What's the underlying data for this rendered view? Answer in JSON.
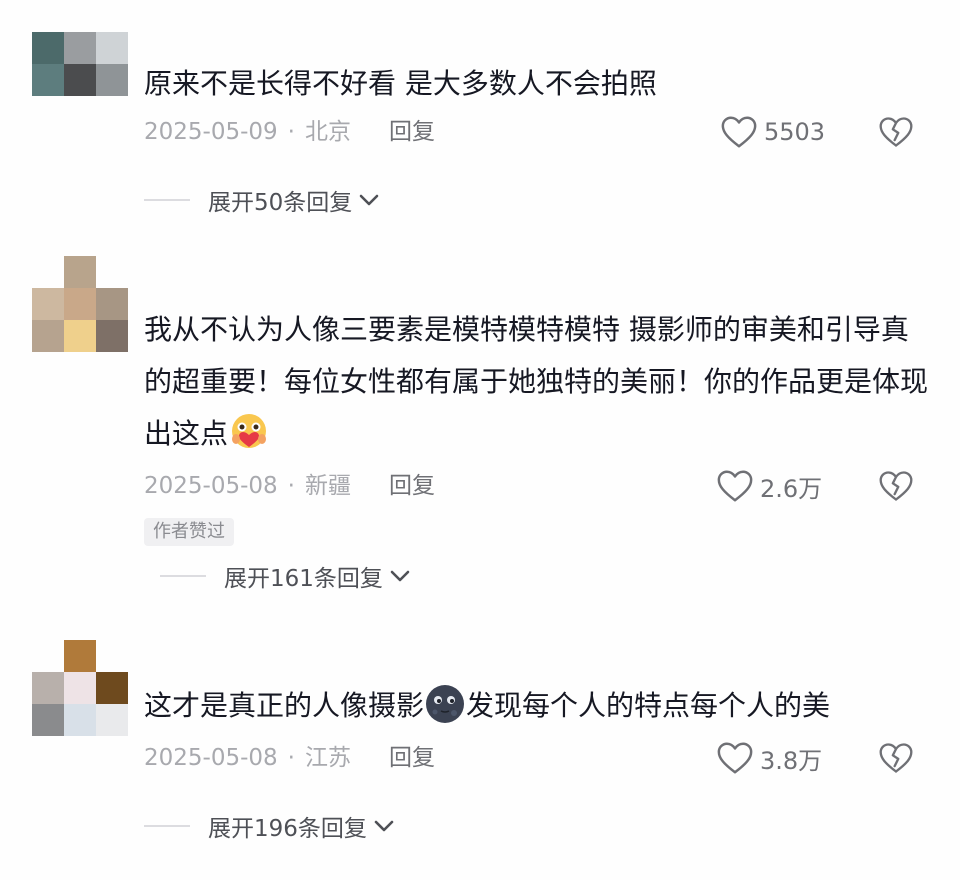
{
  "comments": [
    {
      "text": "原来不是长得不好看 是大多数人不会拍照",
      "date": "2025-05-09",
      "separator": "·",
      "location": "北京",
      "reply_label": "回复",
      "like_count": "5503",
      "expand_label": "展开50条回复"
    },
    {
      "text": "我从不认为人像三要素是模特模特模特 摄影师的审美和引导真的超重要！每位女性都有属于她独特的美丽！你的作品更是体现出这点",
      "date": "2025-05-08",
      "separator": "·",
      "location": "新疆",
      "reply_label": "回复",
      "like_count": "2.6万",
      "badge": "作者赞过",
      "expand_label": "展开161条回复"
    },
    {
      "text_before": "这才是真正的人像摄影",
      "text_after": "发现每个人的特点每个人的美",
      "date": "2025-05-08",
      "separator": "·",
      "location": "江苏",
      "reply_label": "回复",
      "like_count": "3.8万",
      "expand_label": "展开196条回复"
    }
  ],
  "icons": {
    "like": "heart-outline-icon",
    "dislike": "broken-heart-icon",
    "expand": "chevron-down-icon",
    "emoji_1": "hugging-face-emoji",
    "emoji_2": "dark-moon-face-emoji"
  },
  "colors": {
    "text": "#161823",
    "meta": "#a8a9ae",
    "secondary": "#6f7075"
  }
}
